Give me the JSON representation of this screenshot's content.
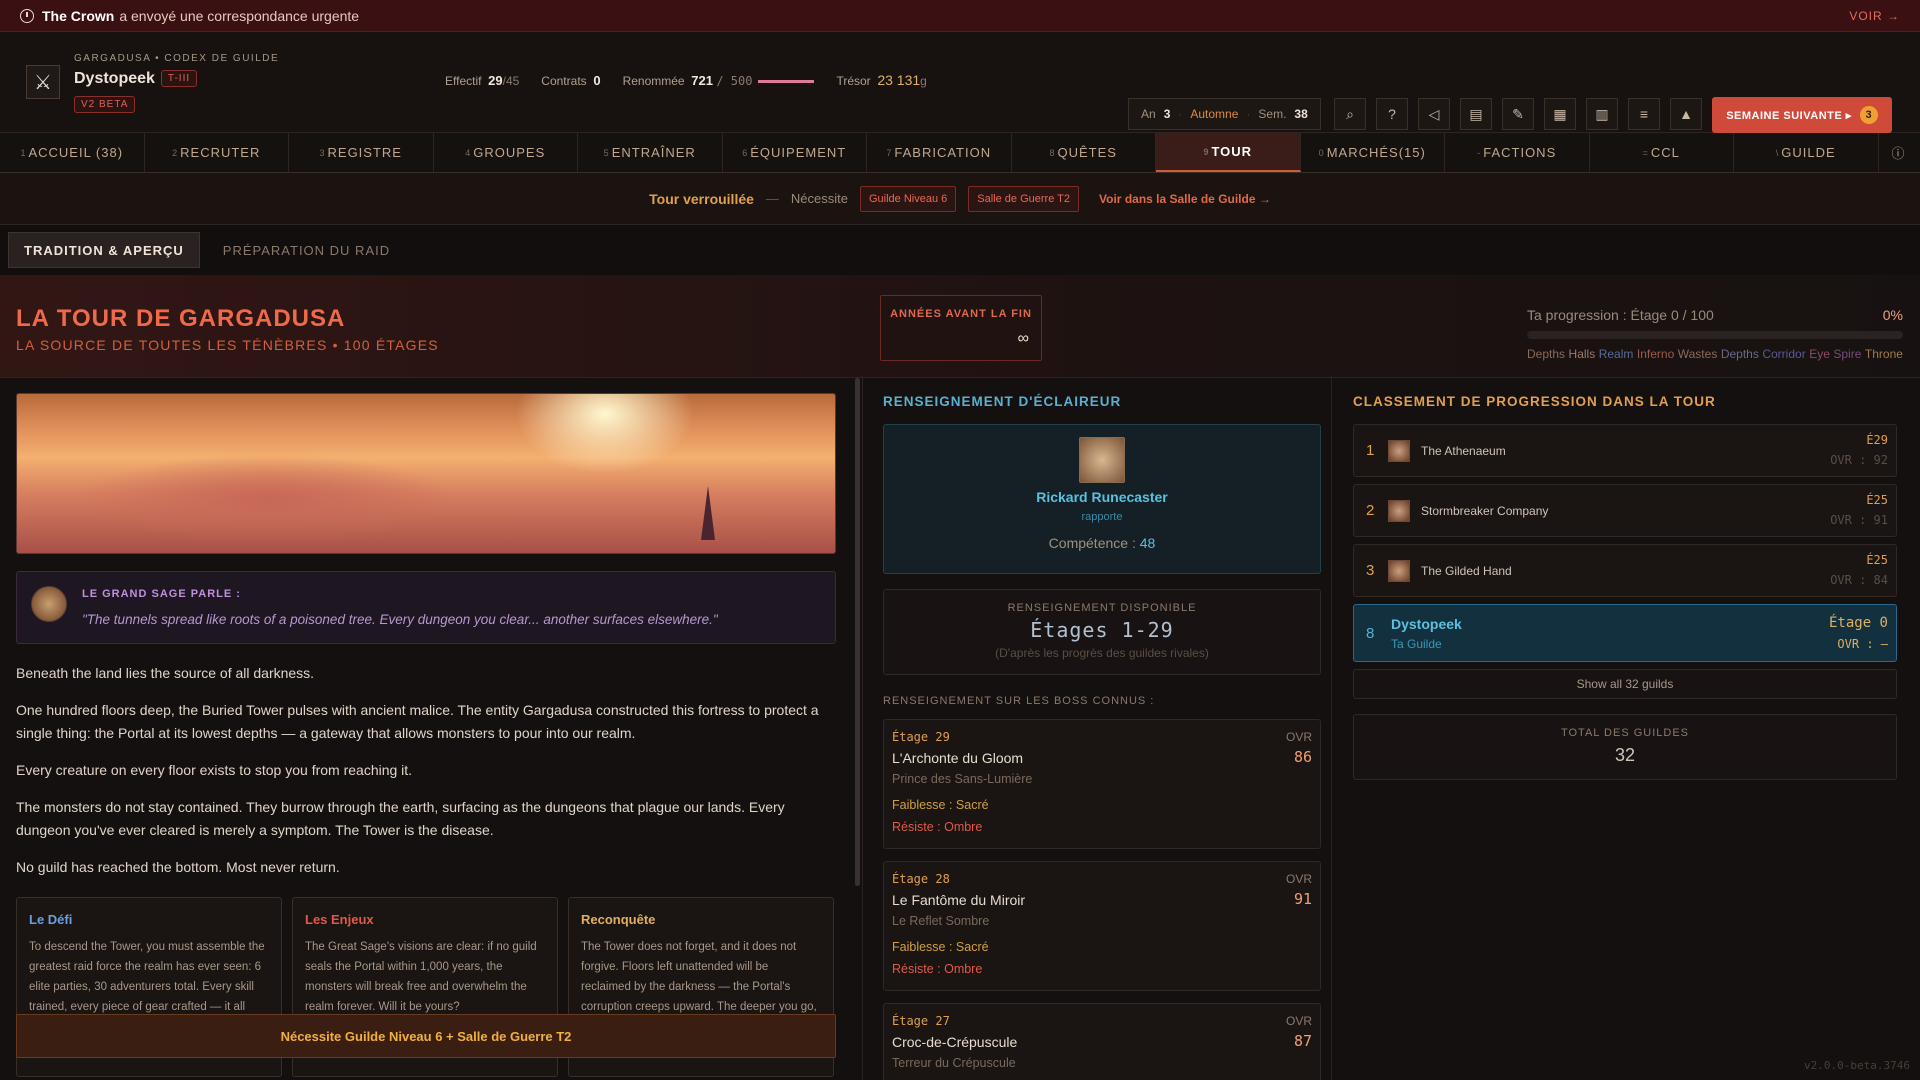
{
  "notification": {
    "sender": "The Crown",
    "message": "a envoyé une correspondance urgente",
    "action": "VOIR →"
  },
  "header": {
    "crumb": "GARGADUSA • CODEX DE GUILDE",
    "guild_name": "Dystopeek",
    "tier": "T-III",
    "beta": "V2 BETA",
    "stats": {
      "effectif_label": "Effectif",
      "effectif": "29",
      "effectif_max": "/45",
      "contrats_label": "Contrats",
      "contrats": "0",
      "renommee_label": "Renommée",
      "renommee": "721",
      "renommee_max": "/ 500",
      "tresor_label": "Trésor",
      "tresor": "23 131",
      "tresor_unit": "g"
    },
    "calendar": {
      "year_label": "An",
      "year": "3",
      "season": "Automne",
      "week_label": "Sem.",
      "week": "38"
    },
    "tools": [
      "search-icon",
      "help-icon",
      "mute-icon",
      "chart-icon",
      "edit-icon",
      "map-icon",
      "clipboard-icon",
      "settings-icon",
      "triangle-icon"
    ],
    "next_week": {
      "label": "SEMAINE SUIVANTE ▸",
      "badge": "3"
    }
  },
  "tabs": [
    {
      "key": "1",
      "label": "ACCUEIL (38)"
    },
    {
      "key": "2",
      "label": "RECRUTER"
    },
    {
      "key": "3",
      "label": "REGISTRE"
    },
    {
      "key": "4",
      "label": "GROUPES"
    },
    {
      "key": "5",
      "label": "ENTRAÎNER"
    },
    {
      "key": "6",
      "label": "ÉQUIPEMENT"
    },
    {
      "key": "7",
      "label": "FABRICATION"
    },
    {
      "key": "8",
      "label": "QUÊTES"
    },
    {
      "key": "9",
      "label": "TOUR"
    },
    {
      "key": "0",
      "label": "MARCHÉS(15)"
    },
    {
      "key": "-",
      "label": "FACTIONS"
    },
    {
      "key": "=",
      "label": "CCL"
    },
    {
      "key": "\\",
      "label": "GUILDE"
    }
  ],
  "lock_bar": {
    "title": "Tour verrouillée",
    "dash": "—",
    "needs": "Nécessite",
    "chip1": "Guilde Niveau 6",
    "chip2": "Salle de Guerre T2",
    "link": "Voir dans la Salle de Guilde →"
  },
  "subtabs": [
    "TRADITION & APERÇU",
    "PRÉPARATION DU RAID"
  ],
  "hero": {
    "title": "LA TOUR DE GARGADUSA",
    "subtitle": "LA SOURCE DE TOUTES LES TÉNÈBRES • 100 ÉTAGES",
    "years_label": "ANNÉES AVANT LA FIN",
    "years_value": "∞",
    "progress_label": "Ta progression : Étage 0 / 100",
    "progress_pct": "0%",
    "progress_value": 0,
    "zones": [
      {
        "name": "Depths",
        "color": "#8a6a5a"
      },
      {
        "name": "Halls",
        "color": "#9a7a6a"
      },
      {
        "name": "Realm",
        "color": "#5a6a9a"
      },
      {
        "name": "Inferno",
        "color": "#a05a4a"
      },
      {
        "name": "Wastes",
        "color": "#8a6a5a"
      },
      {
        "name": "Depths",
        "color": "#6a6a8a"
      },
      {
        "name": "Corridor",
        "color": "#5a5a9a"
      },
      {
        "name": "Eye",
        "color": "#8a4a6a"
      },
      {
        "name": "Spire",
        "color": "#7a4a7a"
      },
      {
        "name": "Throne",
        "color": "#a07a4a"
      }
    ]
  },
  "sage": {
    "label": "LE GRAND SAGE PARLE :",
    "quote": "\"The tunnels spread like roots of a poisoned tree. Every dungeon you clear... another surfaces elsewhere.\""
  },
  "lore": [
    "Beneath the land lies the source of all darkness.",
    "One hundred floors deep, the Buried Tower pulses with ancient malice. The entity Gargadusa constructed this fortress to protect a single thing: the Portal at its lowest depths — a gateway that allows monsters to pour into our realm.",
    "Every creature on every floor exists to stop you from reaching it.",
    "The monsters do not stay contained. They burrow through the earth, surfacing as the dungeons that plague our lands. Every dungeon you've ever cleared is merely a symptom. The Tower is the disease.",
    "No guild has reached the bottom. Most never return."
  ],
  "cards": [
    {
      "title": "Le Défi",
      "color": "#6aa0e0",
      "text": "To descend the Tower, you must assemble the greatest raid force the realm has ever seen: 6 elite parties, 30 adventurers total. Every skill trained, every piece of gear crafted — it all"
    },
    {
      "title": "Les Enjeux",
      "color": "#e05a4a",
      "text": "The Great Sage's visions are clear: if no guild seals the Portal within 1,000 years, the monsters will break free and overwhelm the realm forever. Will it be yours?"
    },
    {
      "title": "Reconquête",
      "color": "#e0b060",
      "text": "The Tower does not forget, and it does not forgive. Floors left unattended will be reclaimed by the darkness — the Portal's corruption creeps upward. The deeper you go, the faster it falls. Garrison your cleared"
    }
  ],
  "requirement": "Nécessite Guilde Niveau 6 + Salle de Guerre T2",
  "scout": {
    "title": "RENSEIGNEMENT D'ÉCLAIREUR",
    "name": "Rickard Runecaster",
    "reports": "rapporte",
    "skill_label": "Compétence :",
    "skill": "48",
    "avail_label": "RENSEIGNEMENT DISPONIBLE",
    "avail_value": "Étages 1-29",
    "avail_note": "(D'après les progrès des guildes rivales)",
    "bosses_label": "RENSEIGNEMENT SUR LES BOSS CONNUS :",
    "bosses": [
      {
        "floor": "Étage 29",
        "name": "L'Archonte du Gloom",
        "epithet": "Prince des Sans-Lumière",
        "ovr_label": "OVR",
        "ovr": "86",
        "weak": "Faiblesse : Sacré",
        "resist": "Résiste : Ombre"
      },
      {
        "floor": "Étage 28",
        "name": "Le Fantôme du Miroir",
        "epithet": "Le Reflet Sombre",
        "ovr_label": "OVR",
        "ovr": "91",
        "weak": "Faiblesse : Sacré",
        "resist": "Résiste : Ombre"
      },
      {
        "floor": "Étage 27",
        "name": "Croc-de-Crépuscule",
        "epithet": "Terreur du Crépuscule",
        "ovr_label": "OVR",
        "ovr": "87",
        "weak": "",
        "resist": ""
      }
    ]
  },
  "ranking": {
    "title": "CLASSEMENT DE PROGRESSION DANS LA TOUR",
    "rows": [
      {
        "pos": "1",
        "name": "The Athenaeum",
        "floor": "É29",
        "ovr": "OVR : 92"
      },
      {
        "pos": "2",
        "name": "Stormbreaker Company",
        "floor": "É25",
        "ovr": "OVR : 91"
      },
      {
        "pos": "3",
        "name": "The Gilded Hand",
        "floor": "É25",
        "ovr": "OVR : 84"
      }
    ],
    "me": {
      "pos": "8",
      "name": "Dystopeek",
      "sub": "Ta Guilde",
      "floor": "Étage 0",
      "ovr": "OVR : —"
    },
    "show_all": "Show all 32 guilds",
    "total_label": "TOTAL DES GUILDES",
    "total": "32"
  },
  "version": "v2.0.0-beta.3746"
}
